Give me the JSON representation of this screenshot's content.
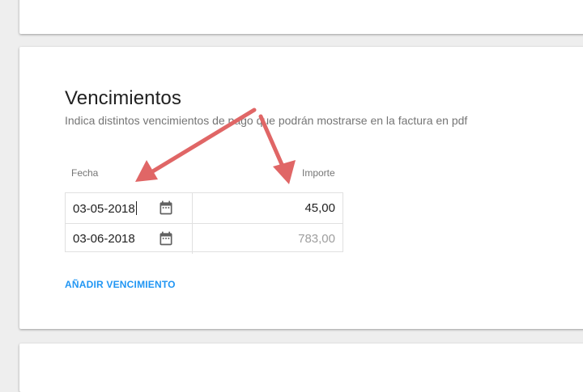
{
  "section": {
    "title": "Vencimientos",
    "description": "Indica distintos vencimientos de pago que podrán mostrarse en la factura en pdf"
  },
  "table": {
    "columns": {
      "date": "Fecha",
      "amount": "Importe"
    },
    "rows": [
      {
        "date": "03-05-2018",
        "amount": "45,00",
        "amount_is_placeholder": false
      },
      {
        "date": "03-06-2018",
        "amount": "783,00",
        "amount_is_placeholder": true
      }
    ]
  },
  "actions": {
    "add_due_date": "AÑADIR VENCIMIENTO"
  },
  "icons": {
    "calendar": "calendar-icon"
  },
  "colors": {
    "accent": "#2196f3",
    "annotation_arrow": "#e06666",
    "background": "#eeeeee",
    "card": "#ffffff"
  }
}
